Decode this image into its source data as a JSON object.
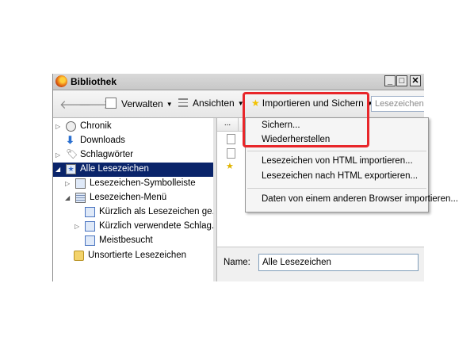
{
  "window": {
    "title": "Bibliothek",
    "controls": [
      "_",
      "□",
      "✕"
    ]
  },
  "toolbar": {
    "back_label": "🡐",
    "forward_label": "🡒",
    "verwalten_label": "Verwalten",
    "ansichten_label": "Ansichten",
    "import_label": "Importieren und Sichern",
    "search_placeholder": "Lesezeichen"
  },
  "tree": {
    "items": [
      {
        "label": "Chronik"
      },
      {
        "label": "Downloads"
      },
      {
        "label": "Schlagwörter"
      },
      {
        "label": "Alle Lesezeichen"
      },
      {
        "label": "Lesezeichen-Symbolleiste"
      },
      {
        "label": "Lesezeichen-Menü"
      },
      {
        "label": "Kürzlich als Lesezeichen ge..."
      },
      {
        "label": "Kürzlich verwendete Schlag..."
      },
      {
        "label": "Meistbesucht"
      },
      {
        "label": "Unsortierte Lesezeichen"
      }
    ]
  },
  "content": {
    "column_button": "..."
  },
  "details": {
    "name_label": "Name:",
    "name_value": "Alle Lesezeichen"
  },
  "menu": {
    "items": [
      "Sichern...",
      "Wiederherstellen",
      "Lesezeichen von HTML importieren...",
      "Lesezeichen nach HTML exportieren...",
      "Daten von einem anderen Browser importieren..."
    ]
  },
  "colors": {
    "highlight": "#e8262a",
    "selection": "#0a246a"
  }
}
